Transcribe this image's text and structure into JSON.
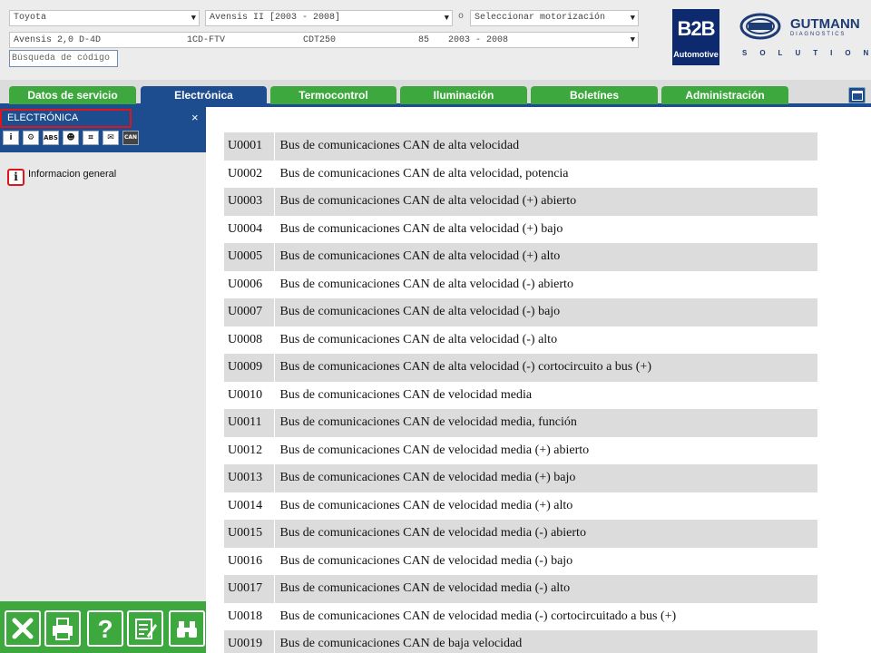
{
  "header": {
    "make_select": "Toyota",
    "model_select": "Avensis II [2003 - 2008]",
    "or_label": "o",
    "engine_select_placeholder": "Seleccionar motorización",
    "engine_detail": {
      "name": "Avensis 2,0 D-4D",
      "engine_code": "1CD-FTV",
      "type_code": "CDT250",
      "power": "85",
      "years": "2003 - 2008"
    },
    "search_placeholder": "Búsqueda de código"
  },
  "logos": {
    "b2b": "B2B",
    "b2b_sub": "Automotive",
    "hella": "HELLA",
    "gutmann": "GUTMANN",
    "gutmann_sub": "DIAGNOSTICS",
    "solutions": "SOLUTIONS"
  },
  "tabs": [
    {
      "label": "Datos de servicio"
    },
    {
      "label": "Electrónica",
      "active": true
    },
    {
      "label": "Termocontrol"
    },
    {
      "label": "Iluminación"
    },
    {
      "label": "Boletínes"
    },
    {
      "label": "Administración"
    }
  ],
  "sidebar": {
    "title": "ELECTRÓNICA",
    "close": "×",
    "tool_icons": [
      {
        "name": "info-icon",
        "glyph": "i"
      },
      {
        "name": "engine-icon",
        "glyph": "⚙"
      },
      {
        "name": "abs-icon",
        "glyph": "ABS"
      },
      {
        "name": "airbag-icon",
        "glyph": "☻"
      },
      {
        "name": "gearbox-icon",
        "glyph": "⌗"
      },
      {
        "name": "comfort-icon",
        "glyph": "✉"
      },
      {
        "name": "can-icon",
        "glyph": "CAN"
      }
    ],
    "info_item": {
      "icon": "i",
      "label": "Informacion general"
    }
  },
  "bottom_buttons": [
    "close-icon",
    "printer-icon",
    "help-icon",
    "notes-icon",
    "binoculars-icon"
  ],
  "codes": [
    {
      "code": "U0001",
      "desc": "Bus de comunicaciones CAN de alta velocidad"
    },
    {
      "code": "U0002",
      "desc": "Bus de comunicaciones CAN de alta velocidad, potencia"
    },
    {
      "code": "U0003",
      "desc": "Bus de comunicaciones CAN de alta velocidad (+) abierto"
    },
    {
      "code": "U0004",
      "desc": "Bus de comunicaciones CAN de alta velocidad (+) bajo"
    },
    {
      "code": "U0005",
      "desc": "Bus de comunicaciones CAN de alta velocidad (+) alto"
    },
    {
      "code": "U0006",
      "desc": "Bus de comunicaciones CAN de alta velocidad (-) abierto"
    },
    {
      "code": "U0007",
      "desc": "Bus de comunicaciones CAN de alta velocidad (-) bajo"
    },
    {
      "code": "U0008",
      "desc": "Bus de comunicaciones CAN de alta velocidad (-) alto"
    },
    {
      "code": "U0009",
      "desc": "Bus de comunicaciones CAN de alta velocidad (-) cortocircuito a bus (+)"
    },
    {
      "code": "U0010",
      "desc": "Bus de comunicaciones CAN de velocidad media"
    },
    {
      "code": "U0011",
      "desc": "Bus de comunicaciones CAN de velocidad media, función"
    },
    {
      "code": "U0012",
      "desc": "Bus de comunicaciones CAN de velocidad media (+) abierto"
    },
    {
      "code": "U0013",
      "desc": "Bus de comunicaciones CAN de velocidad media (+) bajo"
    },
    {
      "code": "U0014",
      "desc": "Bus de comunicaciones CAN de velocidad media (+) alto"
    },
    {
      "code": "U0015",
      "desc": "Bus de comunicaciones CAN de velocidad media (-) abierto"
    },
    {
      "code": "U0016",
      "desc": "Bus de comunicaciones CAN de velocidad media (-) bajo"
    },
    {
      "code": "U0017",
      "desc": "Bus de comunicaciones CAN de velocidad media (-) alto"
    },
    {
      "code": "U0018",
      "desc": "Bus de comunicaciones CAN de velocidad media (-) cortocircuitado a bus (+)"
    },
    {
      "code": "U0019",
      "desc": "Bus de comunicaciones CAN de baja velocidad"
    }
  ],
  "colors": {
    "primary": "#1d4d8e",
    "tab_green": "#3da83d",
    "highlight_red": "#e0141b",
    "row_stripe": "#dcdcdc"
  }
}
